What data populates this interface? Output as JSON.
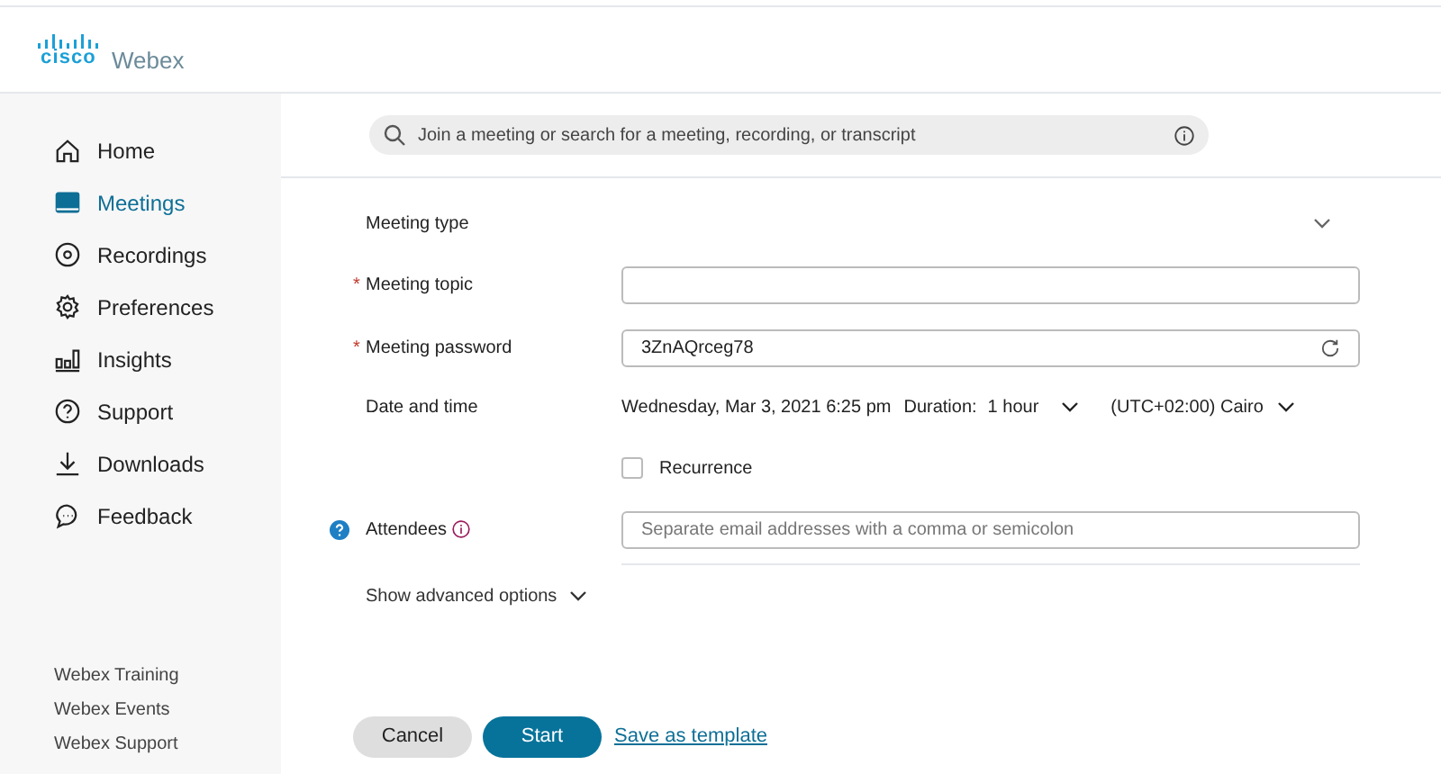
{
  "logo": {
    "brand": "cisco",
    "product": "Webex"
  },
  "sidebar": {
    "items": [
      {
        "label": "Home",
        "selected": false
      },
      {
        "label": "Meetings",
        "selected": true
      },
      {
        "label": "Recordings",
        "selected": false
      },
      {
        "label": "Preferences",
        "selected": false
      },
      {
        "label": "Insights",
        "selected": false
      },
      {
        "label": "Support",
        "selected": false
      },
      {
        "label": "Downloads",
        "selected": false
      },
      {
        "label": "Feedback",
        "selected": false
      }
    ],
    "footer_links": [
      "Webex Training",
      "Webex Events",
      "Webex Support"
    ]
  },
  "search": {
    "placeholder": "Join a meeting or search for a meeting, recording, or transcript"
  },
  "form": {
    "meeting_type": {
      "label": "Meeting type",
      "expanded": false
    },
    "topic": {
      "required_mark": "*",
      "label": "Meeting topic"
    },
    "password": {
      "required_mark": "*",
      "label": "Meeting password",
      "value": "3ZnAQrceg78"
    },
    "date_time": {
      "label": "Date and time",
      "date": "Wednesday, Mar 3, 2021 6:25 pm",
      "duration_label": "Duration:",
      "duration": "1 hour",
      "timezone": "(UTC+02:00) Cairo"
    },
    "recurrence": {
      "label": "Recurrence",
      "checked": false
    },
    "attendees": {
      "label": "Attendees",
      "placeholder": "Separate email addresses with a comma or semicolon"
    },
    "advanced": {
      "label": "Show advanced options",
      "expanded": false
    }
  },
  "buttons": {
    "cancel": "Cancel",
    "start": "Start",
    "template_link": "Save as template"
  }
}
